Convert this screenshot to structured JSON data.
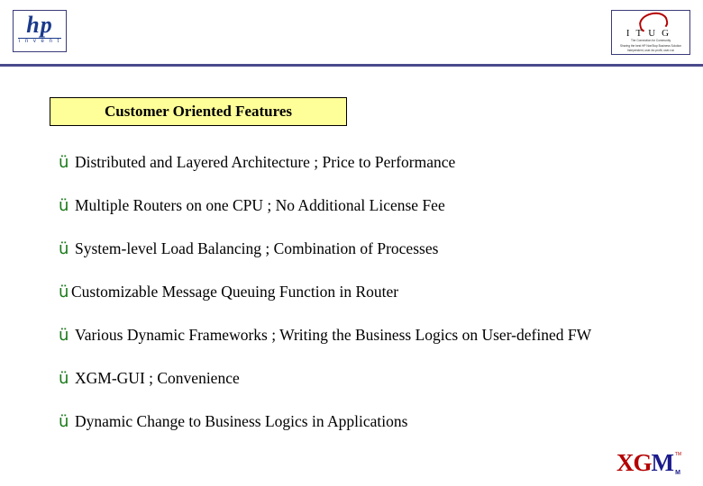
{
  "header": {
    "hp_logo": {
      "letters": "hp",
      "tagline": "i n v e n t"
    },
    "itug_logo": {
      "letters": "ITUG",
      "tagline_line1": "The Connection for Community",
      "tagline_line2": "Sharing the best HP NonStop Business Solution",
      "tagline_line3": "Independent, user-for-profit, user-run"
    }
  },
  "title": {
    "text": "Customer Oriented Features"
  },
  "bullets": [
    {
      "mark": "ü",
      "text": "Distributed and Layered Architecture  ;  Price to Performance",
      "tight": false
    },
    {
      "mark": "ü",
      "text": "Multiple Routers on one CPU  ;  No Additional License Fee",
      "tight": false
    },
    {
      "mark": "ü",
      "text": "System-level Load Balancing  ;  Combination of Processes",
      "tight": false
    },
    {
      "mark": "ü",
      "text": "Customizable Message Queuing Function in Router",
      "tight": true
    },
    {
      "mark": "ü",
      "text": "Various Dynamic Frameworks ; Writing the Business Logics on User-defined FW",
      "tight": false
    },
    {
      "mark": "ü",
      "text": "XGM-GUI  ;  Convenience",
      "tight": false
    },
    {
      "mark": "ü",
      "text": "Dynamic Change to Business Logics in Applications",
      "tight": false
    }
  ],
  "footer": {
    "logo_xg": "XG",
    "logo_m": "M",
    "logo_sub": "M",
    "logo_tm": "TM"
  },
  "colors": {
    "title_background": "#ffff99",
    "header_rule": "#4a4a8c",
    "checkmark": "#1a7a1a",
    "xgm_red": "#b40000",
    "xgm_blue": "#1b1b8c"
  }
}
